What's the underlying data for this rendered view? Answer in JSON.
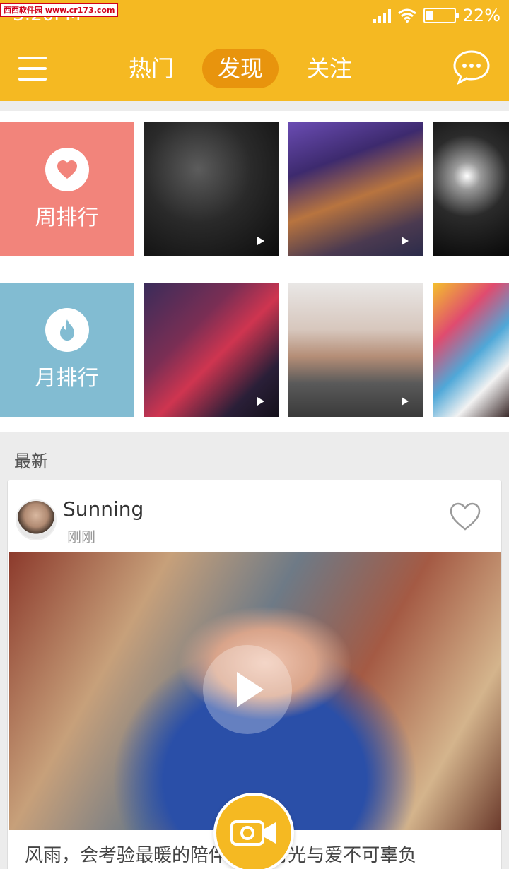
{
  "status_bar": {
    "watermark": "西西软件园 www.cr173.com",
    "time": "3:20PM",
    "battery": "22%"
  },
  "header": {
    "tabs": [
      {
        "label": "热门"
      },
      {
        "label": "发现",
        "active": true
      },
      {
        "label": "关注"
      }
    ],
    "menu_icon": "hamburger-menu-icon",
    "chat_icon": "chat-bubble-icon",
    "accent_color": "#f5b922"
  },
  "rankings": {
    "weekly": {
      "label": "周排行",
      "icon": "heart-icon",
      "color": "#f2847b"
    },
    "monthly": {
      "label": "月排行",
      "icon": "flame-icon",
      "color": "#82bcd2"
    }
  },
  "latest": {
    "section_title": "最新",
    "post": {
      "username": "Sunning",
      "time": "刚刚",
      "caption": "风雨，会考验最暖的陪伴 惟有时光与爱不可辜负"
    }
  }
}
